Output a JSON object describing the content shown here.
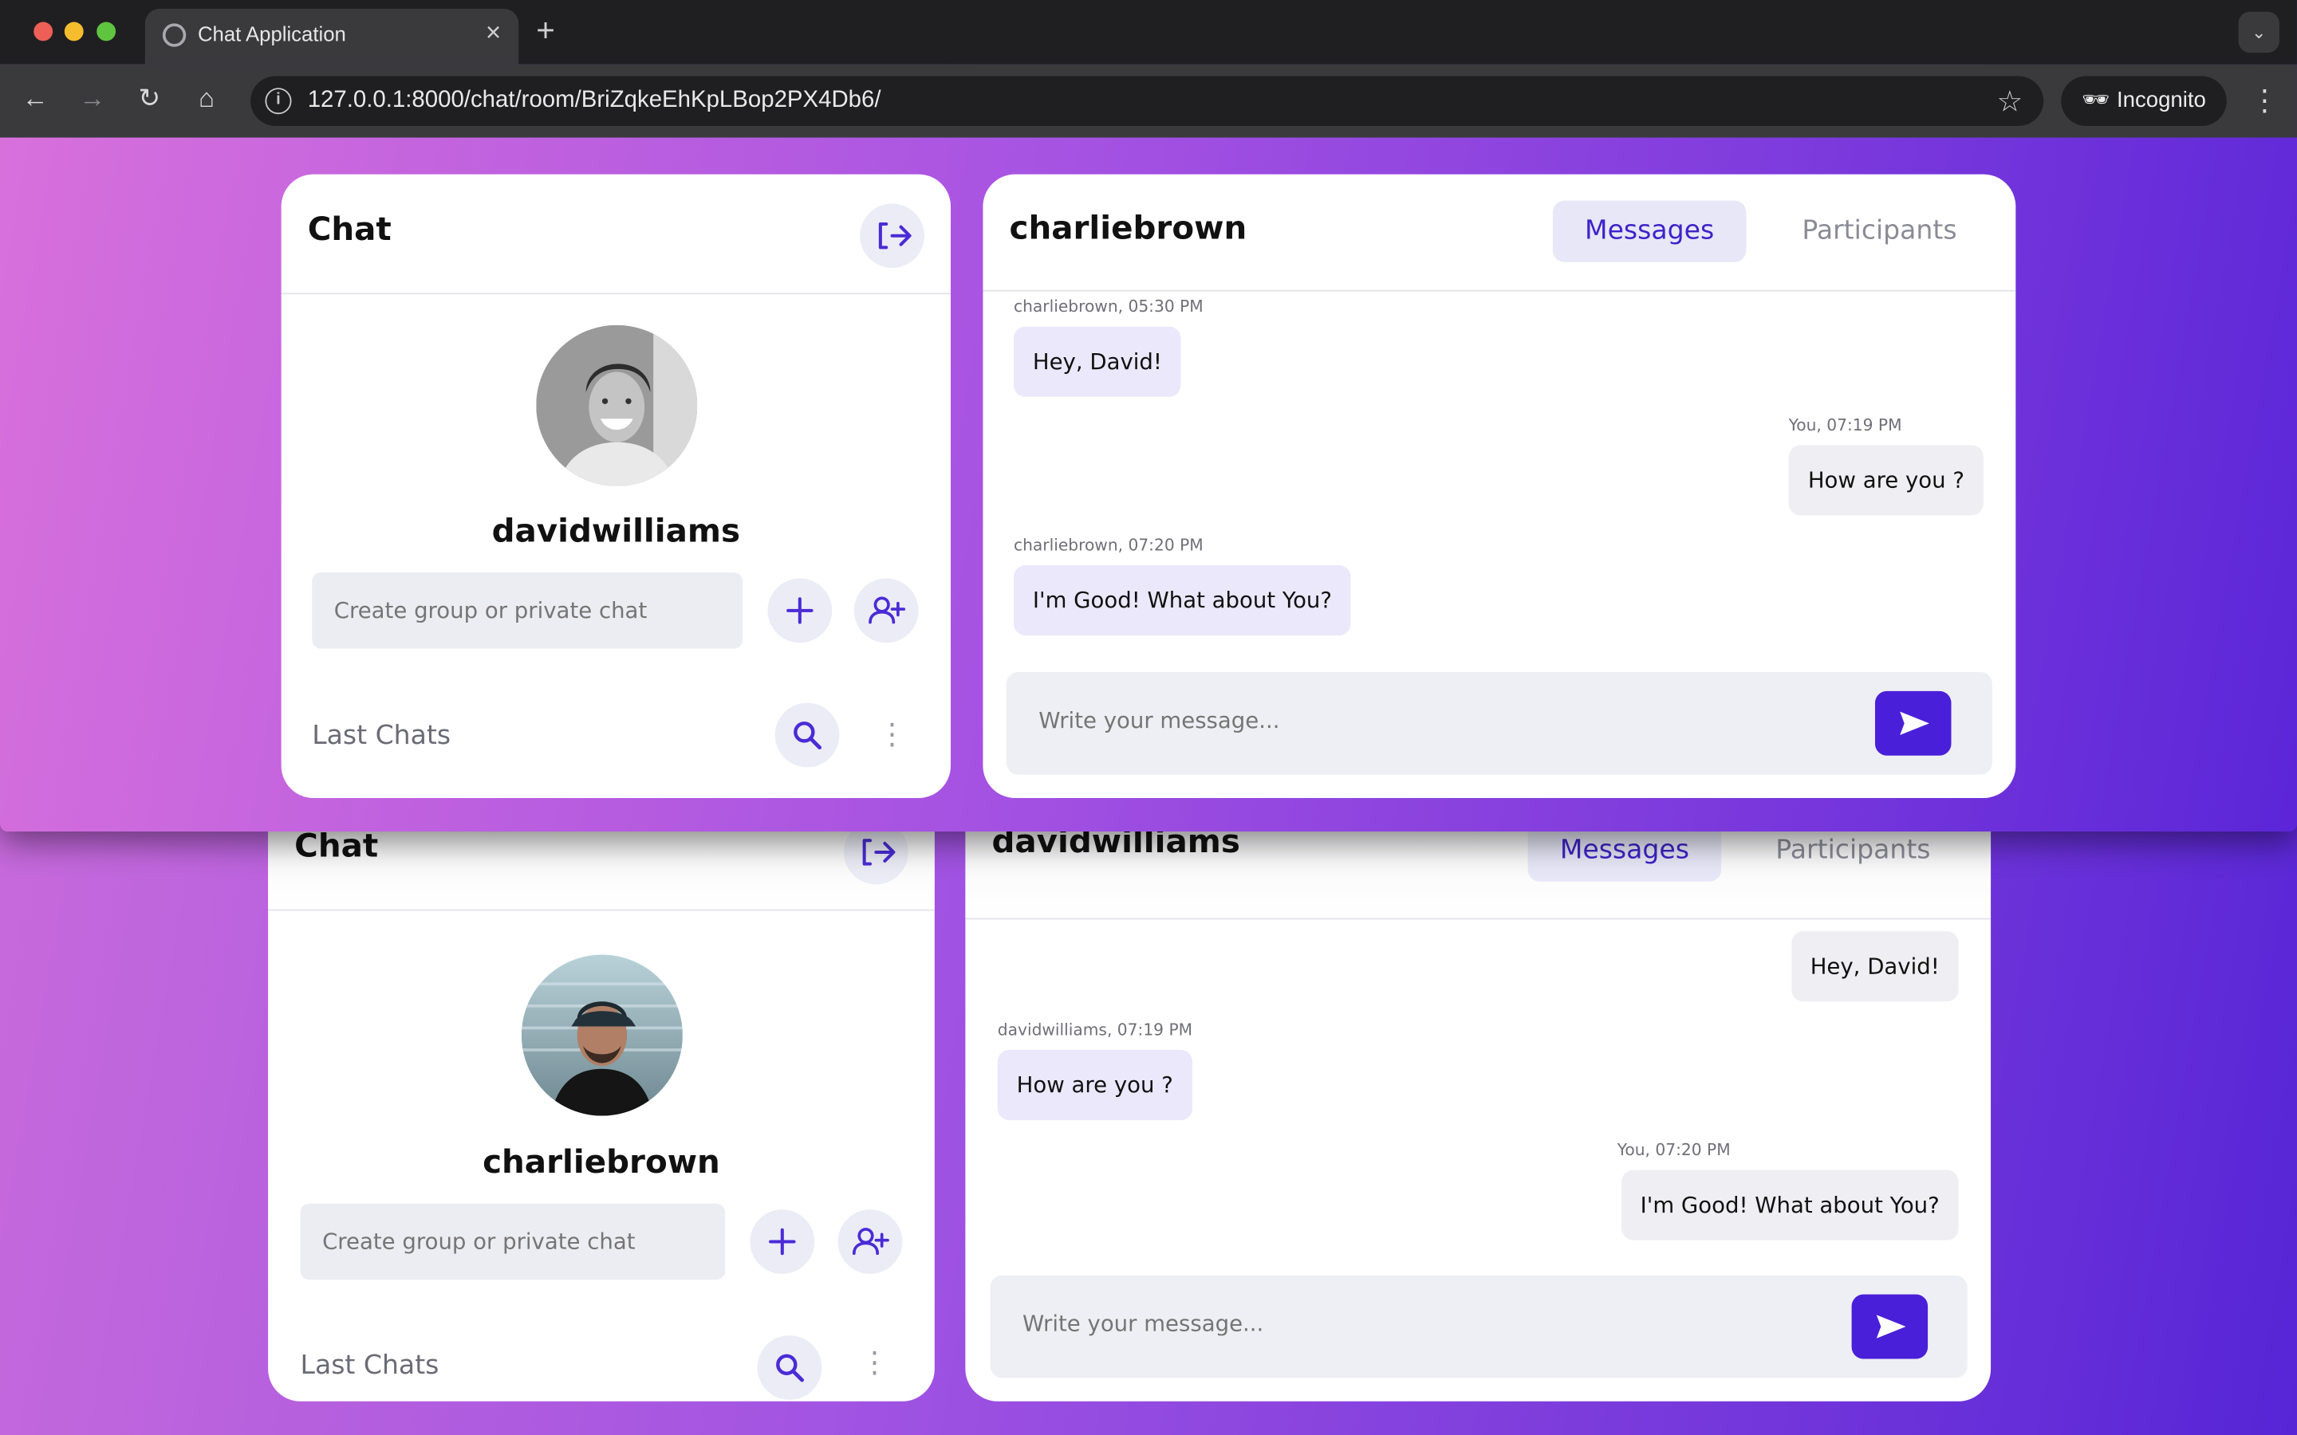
{
  "browser": {
    "tab_title": "Chat Application",
    "url": "127.0.0.1:8000/chat/room/BriZqkeEhKpLBop2PX4Db6/",
    "incognito_label": "Incognito"
  },
  "front": {
    "sidebar": {
      "title": "Chat",
      "username": "davidwilliams",
      "create_placeholder": "Create group or private chat",
      "last_chats_label": "Last Chats"
    },
    "chat": {
      "title": "charliebrown",
      "tabs": [
        {
          "label": "Messages",
          "active": true
        },
        {
          "label": "Participants",
          "active": false
        }
      ],
      "messages": [
        {
          "meta": "charliebrown, 05:30 PM",
          "text": "Hey, David!",
          "side": "in"
        },
        {
          "meta": "You, 07:19 PM",
          "text": "How are you ?",
          "side": "out"
        },
        {
          "meta": "charliebrown, 07:20 PM",
          "text": "I'm Good! What about You?",
          "side": "in"
        }
      ],
      "composer_placeholder": "Write your message..."
    }
  },
  "back": {
    "sidebar": {
      "title": "Chat",
      "username": "charliebrown",
      "create_placeholder": "Create group or private chat",
      "last_chats_label": "Last Chats"
    },
    "chat": {
      "title": "davidwilliams",
      "tabs": [
        {
          "label": "Messages",
          "active": true
        },
        {
          "label": "Participants",
          "active": false
        }
      ],
      "messages": [
        {
          "meta": "",
          "text": "Hey, David!",
          "side": "out"
        },
        {
          "meta": "davidwilliams, 07:19 PM",
          "text": "How are you ?",
          "side": "in"
        },
        {
          "meta": "You, 07:20 PM",
          "text": "I'm Good! What about You?",
          "side": "out"
        }
      ],
      "composer_placeholder": "Write your message..."
    }
  },
  "colors": {
    "accent": "#4a1fd9",
    "bubble_in": "#ebe8fb",
    "bubble_out": "#efeff3"
  },
  "icons": {
    "logout": "logout-icon",
    "plus": "plus-icon",
    "add_user": "add-user-icon",
    "search": "search-icon",
    "send": "send-icon"
  }
}
